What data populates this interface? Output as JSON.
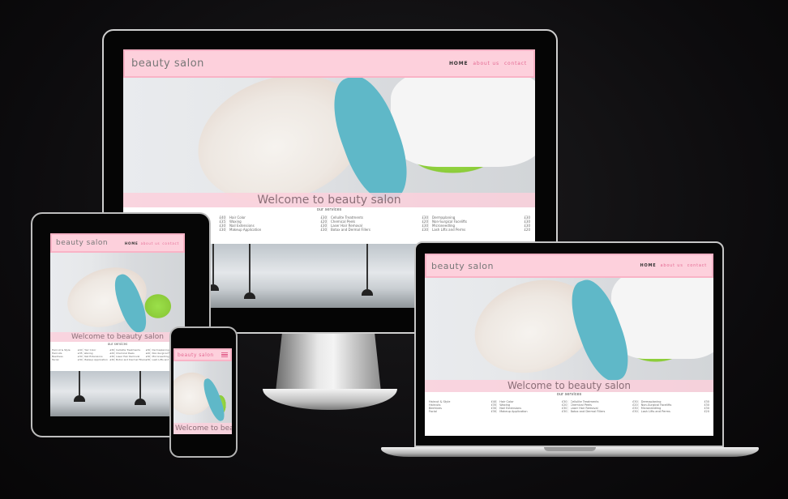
{
  "site": {
    "brand": "beauty salon",
    "nav": {
      "home": "HOME",
      "about": "about us",
      "contact": "contact"
    },
    "welcome": "Welcome to beauty salon",
    "services_title": "our services",
    "services": [
      [
        {
          "name": "Haircut & Style",
          "price": "£40"
        },
        {
          "name": "Haircuts",
          "price": "£35"
        },
        {
          "name": "Beehives",
          "price": "£30"
        },
        {
          "name": "Facial",
          "price": "£30"
        }
      ],
      [
        {
          "name": "Hair Color",
          "price": "£30"
        },
        {
          "name": "Waxing",
          "price": "£20"
        },
        {
          "name": "Nail Extensions",
          "price": "£30"
        },
        {
          "name": "Makeup Application",
          "price": "£30"
        }
      ],
      [
        {
          "name": "Cellulite Treatments",
          "price": "£30"
        },
        {
          "name": "Chemical Peels",
          "price": "£20"
        },
        {
          "name": "Laser Hair Removal",
          "price": "£30"
        },
        {
          "name": "Botox and Dermal Fillers",
          "price": "£30"
        }
      ],
      [
        {
          "name": "Dermaplaning",
          "price": "£30"
        },
        {
          "name": "Non-Surgical Facelifts",
          "price": "£30"
        },
        {
          "name": "Microneedling",
          "price": "£30"
        },
        {
          "name": "Lash Lifts and Perms",
          "price": "£20"
        }
      ]
    ]
  },
  "colors": {
    "nav_bg": "#fdd0dc",
    "nav_border": "#f9b3c6",
    "accent": "#e46a93",
    "page_bg": "#0c0b0d"
  }
}
